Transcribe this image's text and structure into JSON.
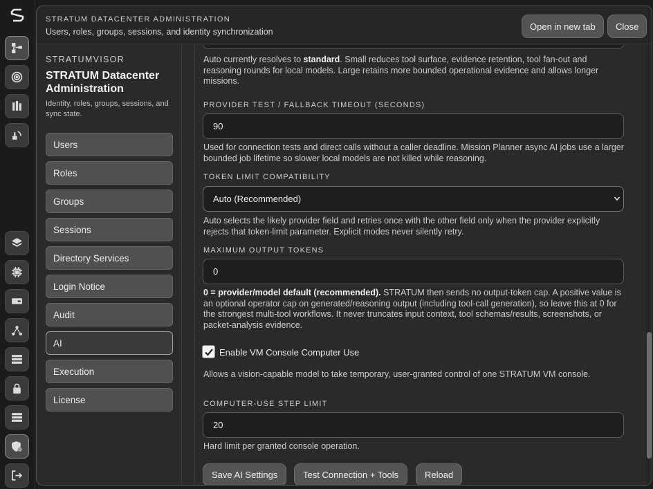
{
  "rail": {
    "icons": [
      "stratum-logo-icon",
      "topology-icon",
      "target-icon",
      "cluster-icon",
      "sensor-icon",
      "layers-icon",
      "chip-icon",
      "drive-icon",
      "network-icon",
      "storage-icon",
      "lock-icon",
      "server-list-icon",
      "shield-user-icon",
      "logout-icon"
    ]
  },
  "header": {
    "eyebrow": "STRATUM DATACENTER ADMINISTRATION",
    "subtitle": "Users, roles, groups, sessions, and identity synchronization",
    "open_tab_label": "Open in new tab",
    "close_label": "Close"
  },
  "nav": {
    "eyebrow": "STRATUMVISOR",
    "title": "STRATUM Datacenter Administration",
    "description": "Identity, roles, groups, sessions, and sync state.",
    "items": [
      {
        "label": "Users"
      },
      {
        "label": "Roles"
      },
      {
        "label": "Groups"
      },
      {
        "label": "Sessions"
      },
      {
        "label": "Directory Services"
      },
      {
        "label": "Login Notice"
      },
      {
        "label": "Audit"
      },
      {
        "label": "AI"
      },
      {
        "label": "Execution"
      },
      {
        "label": "License"
      }
    ],
    "active": "AI"
  },
  "content": {
    "profile_help_prefix": "Auto currently resolves to ",
    "profile_help_bold": "standard",
    "profile_help_rest": ". Small reduces tool surface, evidence retention, tool fan-out and reasoning rounds for local models. Large retains more bounded operational evidence and allows longer missions.",
    "timeout_label": "PROVIDER TEST / FALLBACK TIMEOUT (SECONDS)",
    "timeout_value": "90",
    "timeout_help": "Used for connection tests and direct calls without a caller deadline. Mission Planner async AI jobs use a larger bounded job lifetime so slower local models are not killed while reasoning.",
    "token_compat_label": "TOKEN LIMIT COMPATIBILITY",
    "token_compat_value": "Auto (Recommended)",
    "token_compat_help": "Auto selects the likely provider field and retries once with the other field only when the provider explicitly rejects that token-limit parameter. Explicit modes never silently retry.",
    "max_tokens_label": "MAXIMUM OUTPUT TOKENS",
    "max_tokens_value": "0",
    "max_tokens_help_bold": "0 = provider/model default (recommended).",
    "max_tokens_help_rest": " STRATUM then sends no output-token cap. A positive value is an optional operator cap on generated/reasoning output (including tool-call generation), so leave this at 0 for the strongest multi-tool workflows. It never truncates input context, tool schemas/results, screenshots, or packet-analysis evidence.",
    "vm_console_checked": true,
    "vm_console_label": "Enable VM Console Computer Use",
    "vm_console_help": "Allows a vision-capable model to take temporary, user-granted control of one STRATUM VM console.",
    "step_limit_label": "COMPUTER-USE STEP LIMIT",
    "step_limit_value": "20",
    "step_limit_help": "Hard limit per granted console operation.",
    "save_label": "Save AI Settings",
    "test_label": "Test Connection + Tools",
    "reload_label": "Reload"
  }
}
